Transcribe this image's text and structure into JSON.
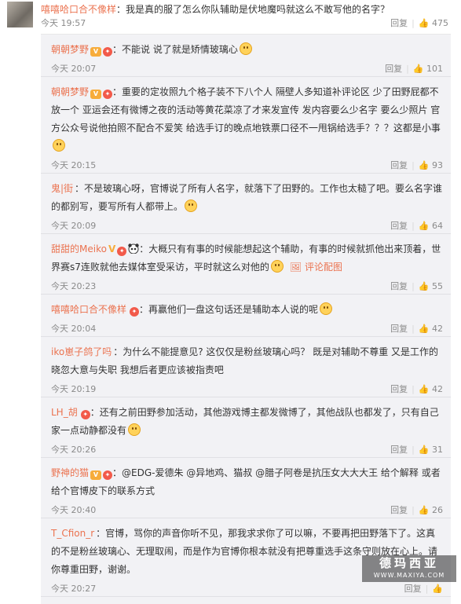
{
  "main": {
    "username": "嘻嘻哈口合不像样",
    "text": "：我是真的服了怎么你队辅助是伏地魔吗就这么不敢写他的名字？",
    "time": "今天 19:57",
    "reply": "回复",
    "likes": "475"
  },
  "replies": [
    {
      "user": "朝朝梦野",
      "badges": [
        "vip",
        "fire"
      ],
      "text": "：不能说 说了就是矫情玻璃心",
      "emoji": "thinking-emoji",
      "time": "今天 20:07",
      "reply": "回复",
      "likes": "101"
    },
    {
      "user": "朝朝梦野",
      "badges": [
        "vip",
        "fire"
      ],
      "text": "：重要的定妆照九个格子装不下八个人 隔壁人多知道补评论区 少了田野屁都不放一个 亚运会还有微博之夜的活动等黄花菜凉了才来发宣传 发内容要么少名字 要么少照片 官方公众号说他拍照不配合不爱笑 给选手订的晚点地铁票口径不一甩锅给选手？？？这都是小事",
      "emoji": "grin-emoji",
      "time": "今天 20:15",
      "reply": "回复",
      "likes": "93"
    },
    {
      "user": "鬼|街",
      "badges": [],
      "text": "：不是玻璃心呀，官博说了所有人名字，就落下了田野的。工作也太糙了吧。要么名字谁的都别写，要写所有人都带上。",
      "emoji": "smile-emoji",
      "time": "今天 20:09",
      "reply": "回复",
      "likes": "64"
    },
    {
      "user": "甜甜的Meiko",
      "badges": [
        "v",
        "fire",
        "panda"
      ],
      "text": "：大概只有有事的时候能想起这个辅助，有事的时候就抓他出来顶着，世界赛s7连败就他去媒体室受采访，平时就这么对他的",
      "emoji": "smile-emoji",
      "pic": "评论配图",
      "time": "今天 20:23",
      "reply": "回复",
      "likes": "55"
    },
    {
      "user": "嘻嘻哈口合不像样",
      "badges": [
        "fire"
      ],
      "text": "：再赢他们一盘这句话还是辅助本人说的呢",
      "emoji": "thumbs-up-emoji",
      "time": "今天 20:04",
      "reply": "回复",
      "likes": "42"
    },
    {
      "user": "iko崽子鸽了吗",
      "badges": [],
      "text": "：为什么不能提意见? 这仅仅是粉丝玻璃心吗？ 既是对辅助不尊重 又是工作的 晓忽大意与失职 我想后者更应该被指责吧",
      "emoji": "",
      "time": "今天 20:19",
      "reply": "回复",
      "likes": "42"
    },
    {
      "user": "LH_胡",
      "badges": [
        "fire"
      ],
      "text": "：还有之前田野参加活动，其他游戏博主都发微博了，其他战队也都发了，只有自己家一点动静都没有",
      "emoji": "thinking-emoji",
      "time": "今天 20:26",
      "reply": "回复",
      "likes": "31"
    },
    {
      "user": "野神的猫",
      "badges": [
        "vip",
        "fire"
      ],
      "text": "：@EDG-爱德朱 @异地鸡、猫叔 @腊子阿卷是抗压女大大大王 给个解释 或者给个官博皮下的联系方式",
      "emoji": "",
      "time": "今天 20:40",
      "reply": "回复",
      "likes": "26"
    },
    {
      "user": "T_Cfion_r",
      "badges": [],
      "text": "：官博，骂你的声音你听不见，那我求求你了可以嘛，不要再把田野落下了。这真的不是粉丝玻璃心、无理取闹，而是作为官博你根本就没有把尊重选手这条守则放在心上。请你尊重田野，谢谢。",
      "emoji": "",
      "time": "今天 20:27",
      "reply": "回复",
      "likes": ""
    }
  ],
  "watermark": {
    "title": "德玛西亚",
    "url": "WWW.MAXIYA.COM"
  },
  "colors": {
    "username": "#eb7350",
    "reply_bg": "#f2f2f5",
    "meta": "#8a8a8a"
  }
}
